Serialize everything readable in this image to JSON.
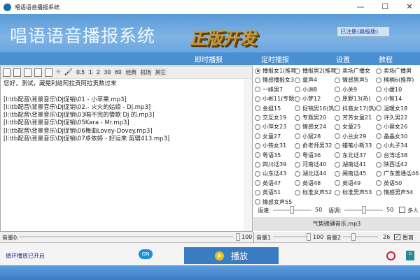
{
  "window": {
    "title": "唱语语音播报系统",
    "minimize": "—",
    "maximize": "☐",
    "close": "✕"
  },
  "header": {
    "app_title": "唱语语音播报系统",
    "logo": "正版开发",
    "registered": "已注册(高级版)"
  },
  "nav": [
    "即时播报",
    "定时播报",
    "设置",
    "教程"
  ],
  "toolbar": {
    "speeds": [
      "0.5",
      "1",
      "2",
      "30",
      "60"
    ],
    "modes": [
      "经典",
      "机场",
      "其它"
    ]
  },
  "editor": {
    "lines": [
      "您好，测试，藏晃利给阿拉贡阿拉贡数过来",
      "",
      "[I:\\tb配音\\背景音乐\\DJ促销\\01 - 小苹果.mp3]",
      "[I:\\tb配音\\背景音乐\\DJ促销\\02.- 火火的姑娘 - Dj.mp3]",
      "[I:\\tb配音\\背景音乐\\DJ促销\\03唱不完的情歌 Dj 的.mp3]",
      "[I:\\tb配音\\背景音乐\\DJ促销\\05Kara - Mr.mp3]",
      "[I:\\tb配音\\背景音乐\\DJ促销\\06舞曲Lovey-Dovey.mp3]",
      "[I:\\tb配音\\背景音乐\\DJ促销\\07卓依婷 - 好运来 剪辑413.mp3]"
    ]
  },
  "voices": {
    "selected": 0,
    "items": [
      "播报女1(推荐)",
      "播报男2(推荐)",
      "卖场广播女",
      "卖场广播男",
      "情感播报女3",
      "童声4",
      "情感男声5",
      "楠楠6(推荐)",
      "一峰男7",
      "小洲8",
      "小关9",
      "小媛10",
      "小彬11(专题)",
      "小梦12",
      "原野13(热)",
      "小智14",
      "金姐15",
      "促销男16(热)",
      "抖音女17(热)",
      "温暖女18",
      "交互女19",
      "专题男20",
      "芳芳女童21",
      "许久男22",
      "小萍女23",
      "情感女24",
      "女童25",
      "小蓉女26",
      "女童27",
      "小斌28",
      "小兰女29",
      "晶晶女30",
      "小铁女31",
      "俞老师男32",
      "蜡笔小新33",
      "小丸子34",
      "粤语35",
      "粤语36",
      "东北话37",
      "台湾话38",
      "四川话39",
      "河南话40",
      "湖南话41",
      "陕西话42",
      "山东话43",
      "湖北话44",
      "闽南话45",
      "广东普通话46",
      "英语47",
      "英语48",
      "英语49",
      "英语50",
      "英语51",
      "标准女声52",
      "标准男声53",
      "情感男声54",
      "情感女声55"
    ]
  },
  "speed": {
    "label1": "语速:",
    "value1": 50,
    "label2": "语调:",
    "value2": 50,
    "multi_label": "多人",
    "multi_checked": false
  },
  "bg_file": "气势磅礴音乐.mp3",
  "volume": {
    "vol0_label": "音量0:",
    "vol0": 100,
    "vol1_label": "音量1",
    "vol1": 100,
    "vol2_label": "音量2",
    "vol2": 26,
    "mute_label": "暂首",
    "mute_checked": true
  },
  "bottom": {
    "loop_text": "循环播放已开启",
    "on_label": "ON",
    "play_label": "播放"
  }
}
